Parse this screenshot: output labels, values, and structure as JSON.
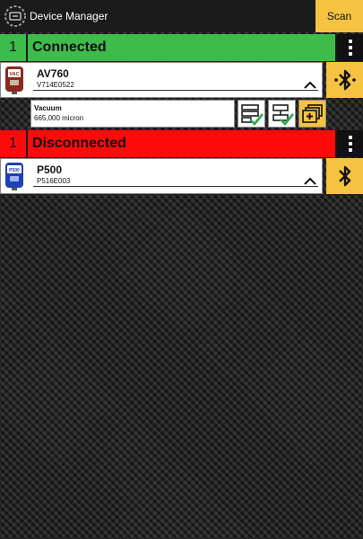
{
  "header": {
    "title": "Device Manager",
    "scan_label": "Scan",
    "logo_icon": "device-manager-logo-icon"
  },
  "colors": {
    "connected": "#3dbb4b",
    "disconnected": "#ff0a0a",
    "accent": "#f5c242"
  },
  "connected": {
    "count": "1",
    "label": "Connected",
    "devices": [
      {
        "name": "AV760",
        "serial": "V714E0522",
        "icon": "vacuum-gauge-icon",
        "icon_text": "VAC",
        "readings": [
          {
            "label": "Vacuum",
            "value": "665,000 micron"
          }
        ]
      }
    ]
  },
  "disconnected": {
    "count": "1",
    "label": "Disconnected",
    "devices": [
      {
        "name": "P500",
        "serial": "P516E003",
        "icon": "pressure-gauge-icon",
        "icon_text": "P500"
      }
    ]
  }
}
